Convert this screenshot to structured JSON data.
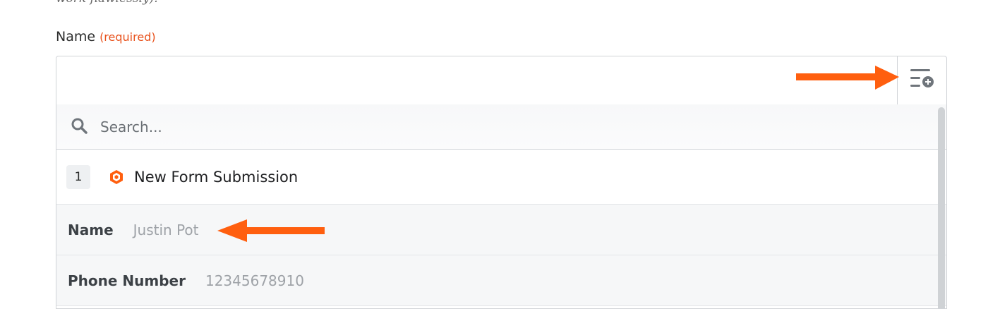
{
  "intro": {
    "clipped_text": "work flawlessly)."
  },
  "field": {
    "label": "Name",
    "required_tag": "(required)",
    "value": ""
  },
  "search": {
    "placeholder": "Search..."
  },
  "step": {
    "number": "1",
    "title": "New Form Submission"
  },
  "items": [
    {
      "key": "Name",
      "value": "Justin Pot"
    },
    {
      "key": "Phone Number",
      "value": "12345678910"
    }
  ],
  "colors": {
    "accent": "#ff5f0f",
    "required": "#e8501a",
    "border": "#d0d3d7"
  },
  "icons": {
    "insert": "insert-data-icon",
    "search": "search-icon",
    "app": "form-app-icon"
  }
}
